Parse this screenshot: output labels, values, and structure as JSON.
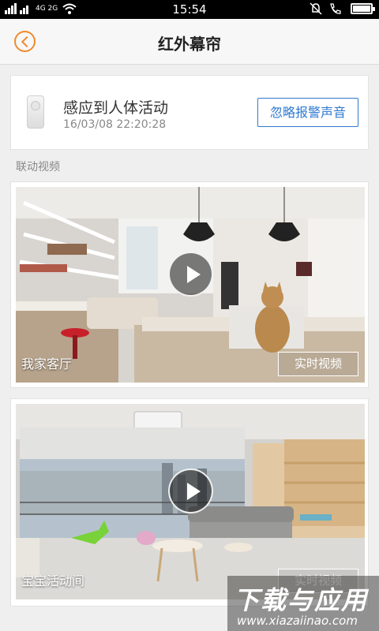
{
  "status_bar": {
    "left_text": "4G 2G",
    "time": "15:54"
  },
  "nav": {
    "title": "红外幕帘"
  },
  "alert": {
    "title": "感应到人体活动",
    "timestamp": "16/03/08 22:20:28",
    "ignore_label": "忽略报警声音"
  },
  "section": {
    "label": "联动视频"
  },
  "videos": [
    {
      "name": "我家客厅",
      "action_label": "实时视频"
    },
    {
      "name": "宝宝活动间",
      "action_label": "实时视频"
    }
  ],
  "watermark": {
    "title": "下载与应用",
    "url": "www.xiazaiinao.com"
  },
  "colors": {
    "accent_orange": "#f08a2c",
    "link_blue": "#2f7ad0"
  }
}
